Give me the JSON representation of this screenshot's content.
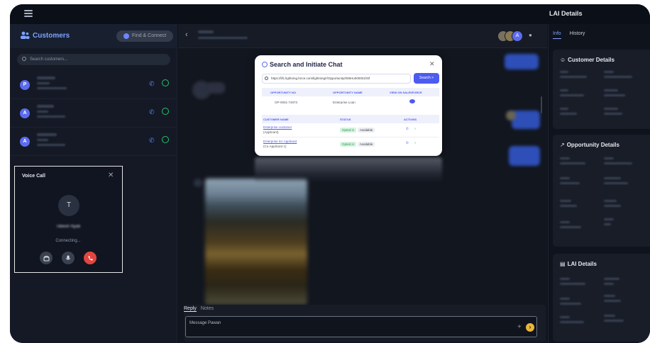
{
  "topbar": {
    "right_title": "LAI Details"
  },
  "sidebar": {
    "title": "Customers",
    "find_button": "Find & Connect",
    "search_placeholder": "Search customers...",
    "customers": [
      {
        "initial": "P"
      },
      {
        "initial": "A"
      },
      {
        "initial": "A"
      }
    ]
  },
  "voice_call": {
    "title": "Voice Call",
    "avatar_initial": "T",
    "caller_name": "Tilbesh Nyati",
    "status": "Connecting..."
  },
  "chat": {
    "reply_tab": "Reply",
    "notes_tab": "Notes",
    "message_placeholder": "Message Pawan",
    "header_avatar_initial": "A"
  },
  "modal": {
    "title": "Search and Initiate Chat",
    "url_value": "https://lifc.lightning.force.com/lightning/r/Opportunity/006Ho000001f4tf",
    "search_button": "Search >",
    "opp_headers": [
      "OPPORTUNITY NO",
      "OPPORTUNITY NAME",
      "VIEW ON SALESFORCE"
    ],
    "opp_row": [
      "OP-0001-74873",
      "Enterprise Loan"
    ],
    "cust_headers": [
      "CUSTOMER NAME",
      "STATUS",
      "ACTIONS"
    ],
    "customers": [
      {
        "name": "Enterprise customer",
        "role": "(Applicant)",
        "status": "Opted in",
        "availability": "Available"
      },
      {
        "name": "Enterprise Inc Applicant",
        "role": "(Co-Applicant 1)",
        "status": "Opted in",
        "availability": "Available"
      }
    ]
  },
  "right_panel": {
    "tabs": [
      "Info",
      "History"
    ],
    "cards": [
      "Customer Details",
      "Opportunity Details",
      "LAI Details"
    ]
  }
}
